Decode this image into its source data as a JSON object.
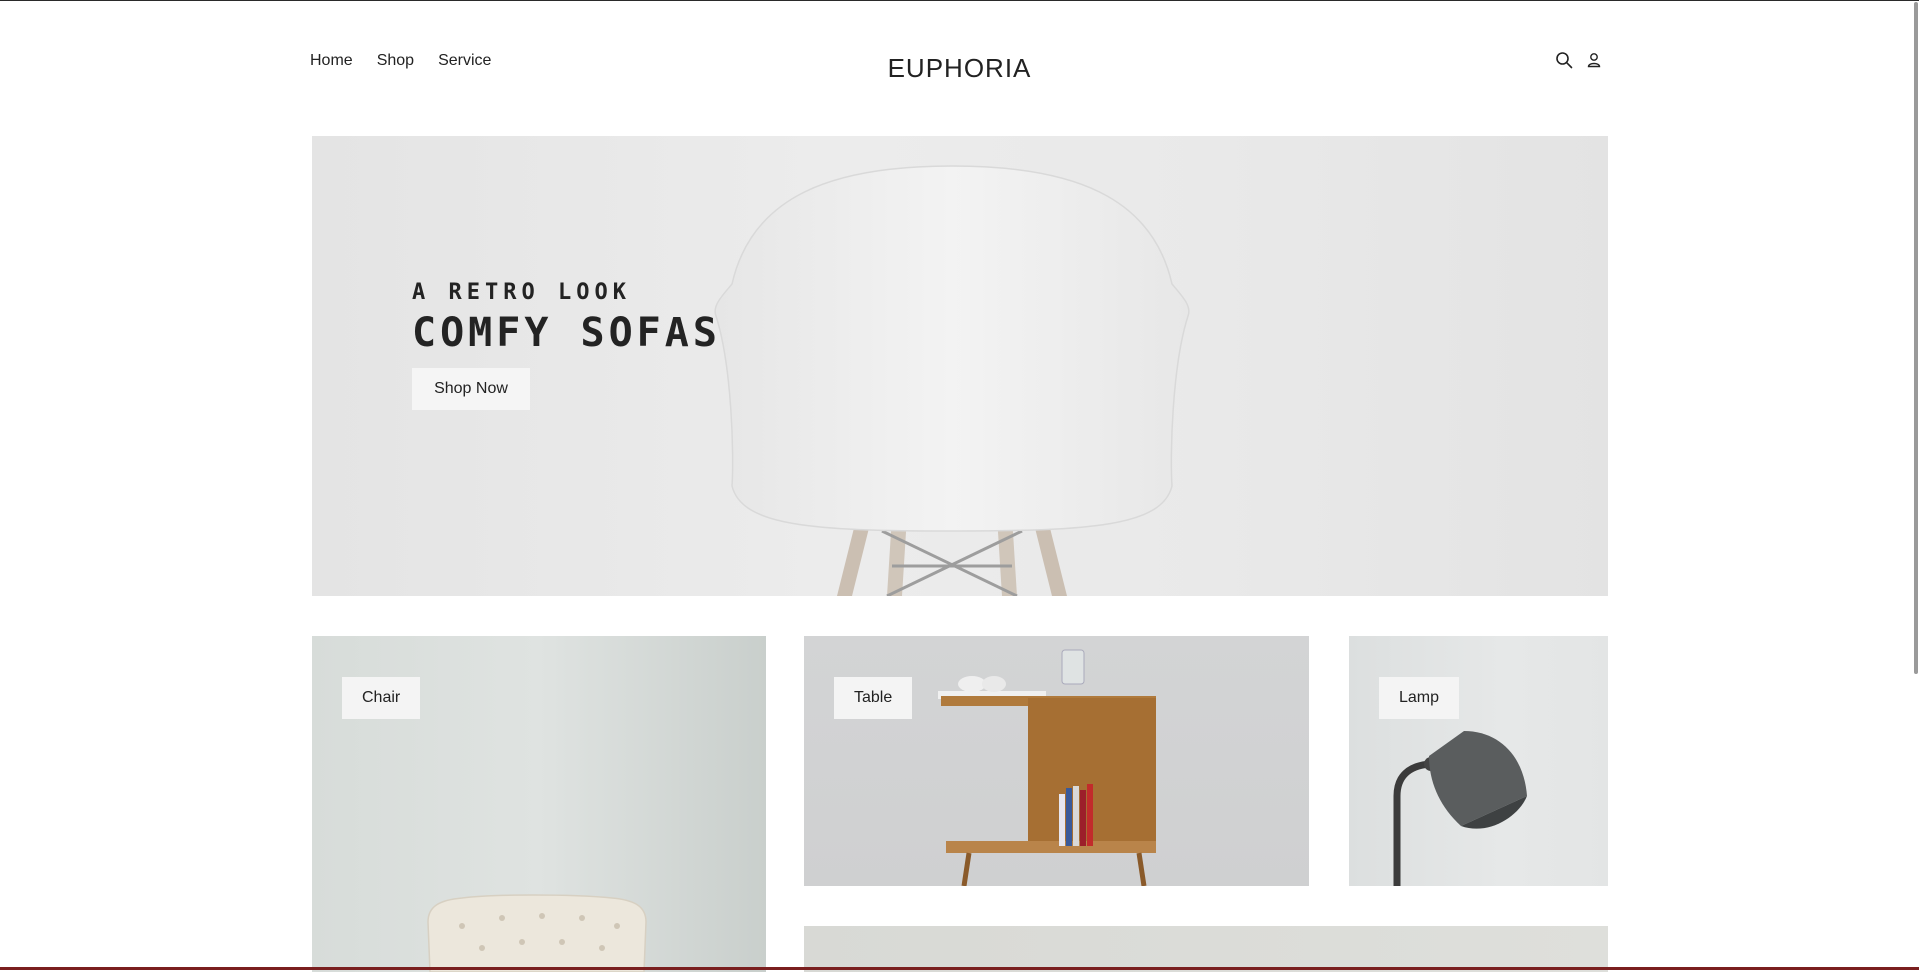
{
  "nav": {
    "items": [
      "Home",
      "Shop",
      "Service"
    ]
  },
  "brand": {
    "name": "EUPHORIA"
  },
  "icons": {
    "search": "search-icon",
    "account": "user-icon"
  },
  "hero": {
    "subtitle": "A RETRO LOOK",
    "title": "COMFY SOFAS",
    "cta": "Shop Now"
  },
  "categories": [
    "Chair",
    "Table",
    "Lamp"
  ],
  "colors": {
    "accent_bottom": "#7a1f1f",
    "hero_bg": "#e8e8e8"
  }
}
